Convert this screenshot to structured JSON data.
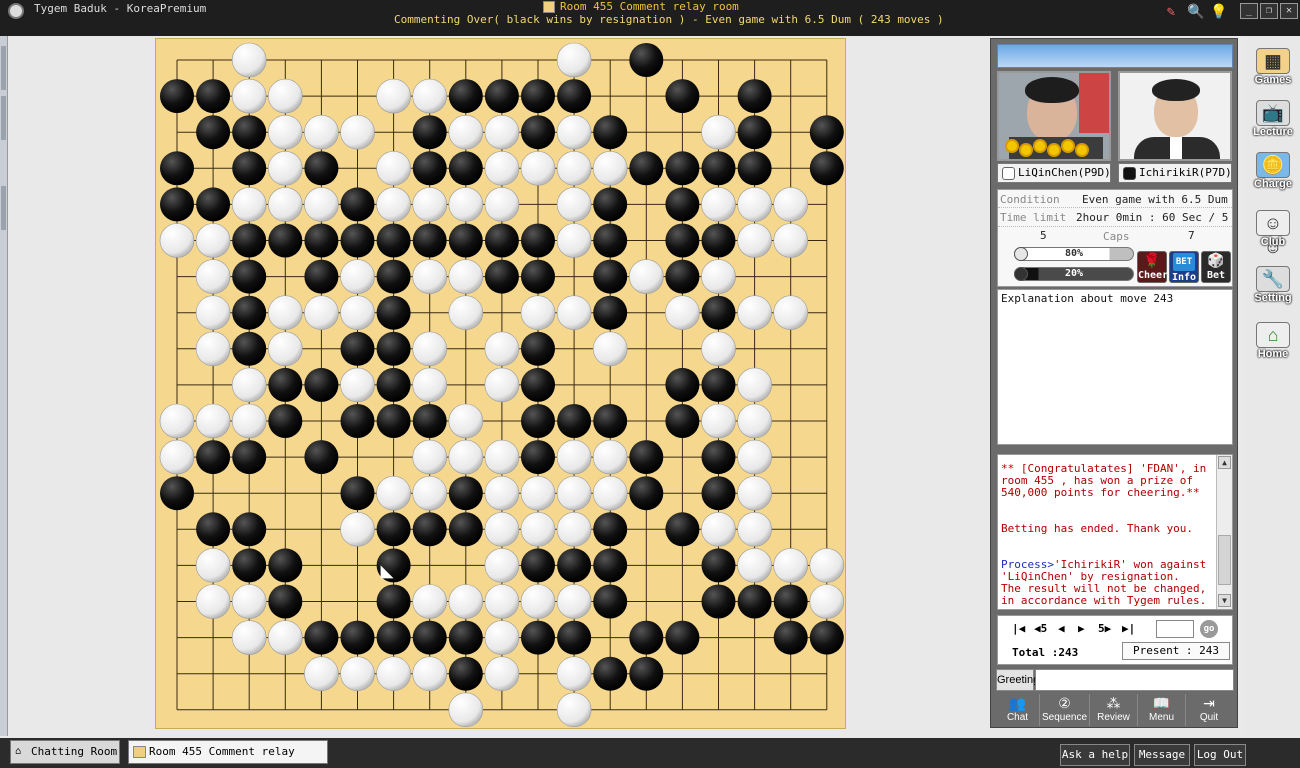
{
  "window": {
    "app_title": "Tygem Baduk - KoreaPremium",
    "room_title": "Room 455 Comment relay room",
    "room_subtitle": "Commenting Over( black wins by resignation ) - Even game with 6.5 Dum  ( 243 moves )"
  },
  "players": {
    "white": {
      "name": "LiQinChen(P9D)"
    },
    "black": {
      "name": "IchirikiR(P7D)"
    }
  },
  "game_info": {
    "condition_label": "Condition",
    "condition_value": "Even game with 6.5 Dum",
    "time_limit_label": "Time limit",
    "time_limit_value": "2hour 0min : 60 Sec / 5",
    "caps_label": "Caps",
    "white_caps": "5",
    "black_caps": "7",
    "white_cheer_pct": 80,
    "white_cheer_text": "80%",
    "black_cheer_pct": 20,
    "black_cheer_text": "20%",
    "cheer_label": "Cheer",
    "info_label": "Info",
    "bet_label": "Bet",
    "bet_badge": "BET"
  },
  "explanation": {
    "text": "Explanation about move 243"
  },
  "chat": {
    "messages": [
      {
        "style": "red",
        "text": "** [Congratulatates] 'FDAN', in room 455 , has won a prize of 540,000 points for cheering.**"
      },
      {
        "style": "red",
        "text": "Betting has ended. Thank you."
      },
      {
        "style": "blue_red",
        "prefix": "Process>",
        "text": "'IchirikiR' won against 'LiQinChen' by resignation.",
        "text2": "The result will not be changed, in accordance with Tygem rules."
      }
    ]
  },
  "navigation": {
    "first": "|◀",
    "back5": "◀5",
    "back1": "◀",
    "fwd1": "▶",
    "fwd5": "5▶",
    "last": "▶|",
    "move_input_value": "",
    "go_label": "go",
    "total_label": "Total :243",
    "present_label": "Present : 243"
  },
  "greeting": {
    "label": "Greeting",
    "input_value": ""
  },
  "bottom_buttons": [
    "Chat",
    "Sequence",
    "Review",
    "Menu",
    "Quit"
  ],
  "side_toolbar": [
    "Games",
    "Lecture",
    "Charge",
    "Club",
    "Setting",
    "Home"
  ],
  "taskbar": {
    "tab1": "Chatting Room",
    "tab2": "Room 455 Comment relay room",
    "ask_help": "Ask a help",
    "message": "Message",
    "logout": "Log Out"
  },
  "colors": {
    "board": "#f5d88e",
    "board_line": "#3a2a10",
    "panel": "#6b6b6b",
    "title_accent": "#f0c040"
  },
  "board": {
    "size": 19,
    "last_move": [
      6,
      14
    ],
    "rows": [
      "..W........W.B.....",
      "BBWW..WWBBBB..B.B..",
      ".BBWWW.BWWBWB..WB.B",
      "B.BWB.WBBWWWWBBBB.B",
      "BBWWWBWWWW.WB.BWWW.",
      "WWBBBBBBBBBWB.BBWW.",
      ".WB.BWBWWBB.BWBW...",
      ".WBWWWB.W.WWB.WBWW.",
      ".WBW.BBW.WB.W..W...",
      "..WBBWBW.WB...BBW..",
      "WWWB.BBBW.BBB.BWW..",
      "WBB.B..WWWBWWB.BW..",
      "B....BWWBWWWWB.BW..",
      ".BB..WBBBWWWB.BWW..",
      ".WBB..B..WBBB..BWWW",
      ".WWB..BWWWWWB..BBBW",
      "..WWBBBBBWBB.BB..BB",
      "....WWWWBW.WBB.....",
      "........W..W......."
    ]
  }
}
